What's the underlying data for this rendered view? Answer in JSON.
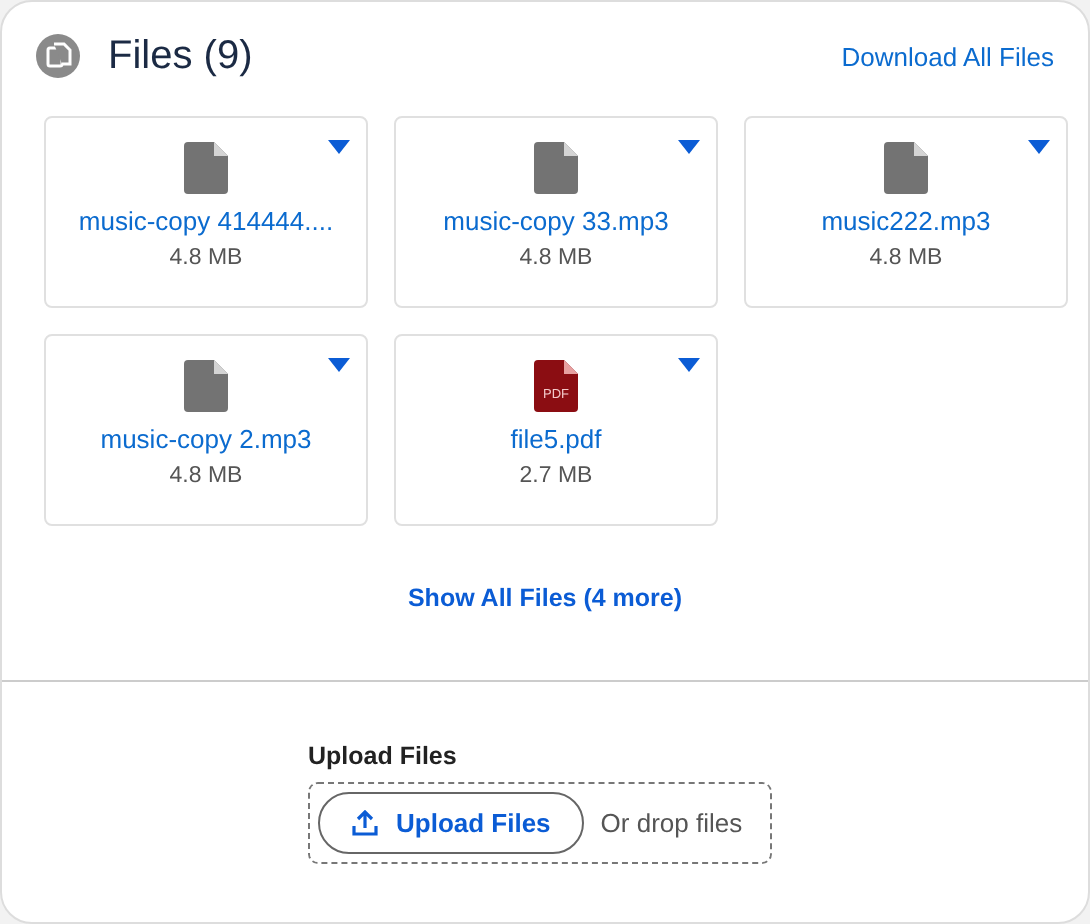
{
  "header": {
    "title": "Files (9)",
    "action": "Download All Files"
  },
  "files": [
    {
      "kind": "generic",
      "name": "music-copy 414444....",
      "size": "4.8 MB"
    },
    {
      "kind": "generic",
      "name": "music-copy 33.mp3",
      "size": "4.8 MB"
    },
    {
      "kind": "generic",
      "name": "music222.mp3",
      "size": "4.8 MB"
    },
    {
      "kind": "generic",
      "name": "music-copy 2.mp3",
      "size": "4.8 MB"
    },
    {
      "kind": "pdf",
      "name": "file5.pdf",
      "size": "2.7 MB",
      "icon_label": "PDF"
    }
  ],
  "show_all": "Show All Files (4 more)",
  "upload": {
    "label": "Upload Files",
    "button": "Upload Files",
    "hint": "Or drop files"
  }
}
